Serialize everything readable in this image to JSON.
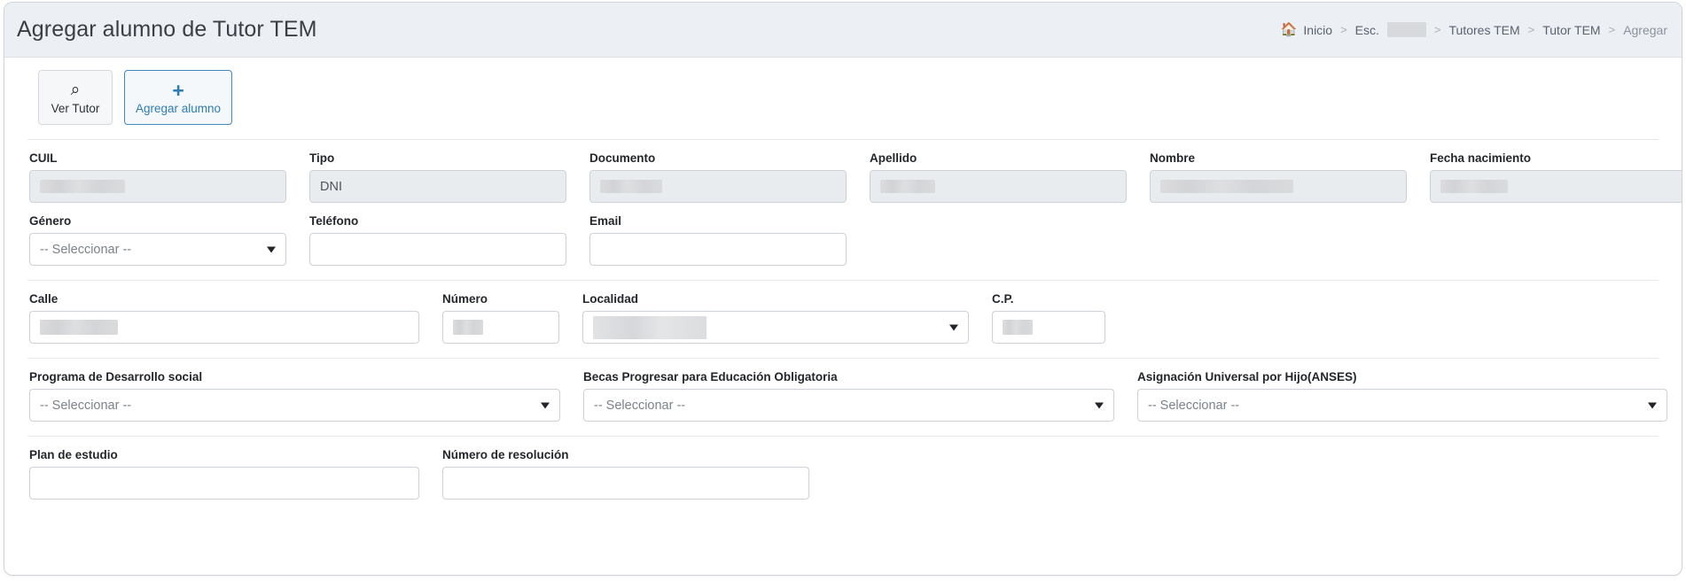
{
  "header": {
    "title": "Agregar alumno de Tutor TEM"
  },
  "breadcrumb": {
    "home_icon": "home-icon",
    "items": [
      {
        "label": "Inicio",
        "redacted": false,
        "current": false
      },
      {
        "label": "Esc.",
        "redacted": true,
        "current": false
      },
      {
        "label": "Tutores TEM",
        "redacted": false,
        "current": false
      },
      {
        "label": "Tutor TEM",
        "redacted": false,
        "current": false
      },
      {
        "label": "Agregar",
        "redacted": false,
        "current": true
      }
    ],
    "separator": ">"
  },
  "toolbar": {
    "buttons": [
      {
        "label": "Ver Tutor",
        "icon": "search-icon",
        "glyph": "⌕",
        "active": false
      },
      {
        "label": "Agregar alumno",
        "icon": "plus-icon",
        "glyph": "+",
        "active": true
      }
    ]
  },
  "form": {
    "rows": [
      {
        "fields": [
          {
            "label": "CUIL",
            "type": "text",
            "disabled": true,
            "value": "",
            "redacted": true,
            "redact_width": 96
          },
          {
            "label": "Tipo",
            "type": "text",
            "disabled": true,
            "value": "DNI",
            "redacted": false
          },
          {
            "label": "Documento",
            "type": "text",
            "disabled": true,
            "value": "",
            "redacted": true,
            "redact_width": 70
          },
          {
            "label": "Apellido",
            "type": "text",
            "disabled": true,
            "value": "",
            "redacted": true,
            "redact_width": 62
          },
          {
            "label": "Nombre",
            "type": "text",
            "disabled": true,
            "value": "",
            "redacted": true,
            "redact_width": 150
          },
          {
            "label": "Fecha nacimiento",
            "type": "text",
            "disabled": true,
            "value": "",
            "redacted": true,
            "redact_width": 76
          }
        ]
      },
      {
        "fields": [
          {
            "label": "Género",
            "type": "select",
            "disabled": false,
            "value": "-- Seleccionar --",
            "redacted": false
          },
          {
            "label": "Teléfono",
            "type": "text",
            "disabled": false,
            "value": "",
            "redacted": false
          },
          {
            "label": "Email",
            "type": "text",
            "disabled": false,
            "value": "",
            "redacted": false
          }
        ]
      },
      {
        "fields": [
          {
            "label": "Calle",
            "type": "text",
            "disabled": false,
            "value": "",
            "redacted": true,
            "redact_width": 88
          },
          {
            "label": "Número",
            "type": "text",
            "disabled": false,
            "value": "",
            "redacted": true,
            "redact_width": 34
          },
          {
            "label": "Localidad",
            "type": "select",
            "disabled": false,
            "value": "",
            "redacted": true,
            "redact_width": 128,
            "redact_two_line": true
          },
          {
            "label": "C.P.",
            "type": "text",
            "disabled": false,
            "value": "",
            "redacted": true,
            "redact_width": 34
          }
        ]
      },
      {
        "fields": [
          {
            "label": "Programa de Desarrollo social",
            "type": "select",
            "disabled": false,
            "value": "-- Seleccionar --",
            "redacted": false
          },
          {
            "label": "Becas Progresar para Educación Obligatoria",
            "type": "select",
            "disabled": false,
            "value": "-- Seleccionar --",
            "redacted": false
          },
          {
            "label": "Asignación Universal por Hijo(ANSES)",
            "type": "select",
            "disabled": false,
            "value": "-- Seleccionar --",
            "redacted": false
          }
        ]
      },
      {
        "fields": [
          {
            "label": "Plan de estudio",
            "type": "text",
            "disabled": false,
            "value": "",
            "redacted": false
          },
          {
            "label": "Número de resolución",
            "type": "text",
            "disabled": false,
            "value": "",
            "redacted": false
          }
        ]
      }
    ]
  },
  "colors": {
    "accent": "#2d7db5",
    "header_bg": "#eceff4",
    "disabled_bg": "#e9ecef",
    "border": "#cdd2d8",
    "label": "#23272c"
  }
}
